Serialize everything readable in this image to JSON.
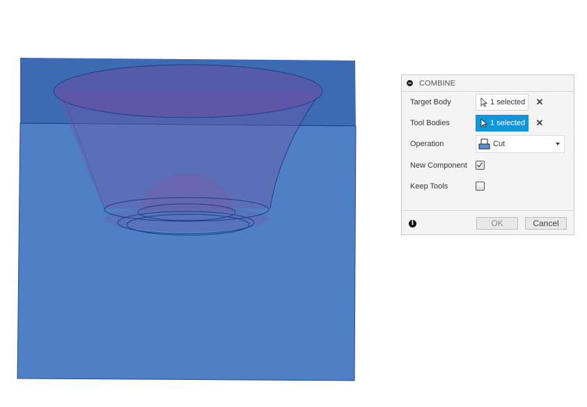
{
  "panel": {
    "title": "COMBINE",
    "target_body": {
      "label": "Target Body",
      "value": "1 selected",
      "active": false
    },
    "tool_bodies": {
      "label": "Tool Bodies",
      "value": "1 selected",
      "active": true
    },
    "operation": {
      "label": "Operation",
      "value": "Cut",
      "icon": "cut-operation-icon"
    },
    "new_component": {
      "label": "New Component",
      "checked": true
    },
    "keep_tools": {
      "label": "Keep Tools",
      "checked": false
    },
    "ok_label": "OK",
    "cancel_label": "Cancel",
    "clear_glyph": "✕"
  },
  "viewport": {
    "colors": {
      "top_face": "#3c6bb4",
      "front_face": "#4f80c6",
      "tool_body": "#6a5aa8",
      "edge": "#1a3f86"
    }
  }
}
